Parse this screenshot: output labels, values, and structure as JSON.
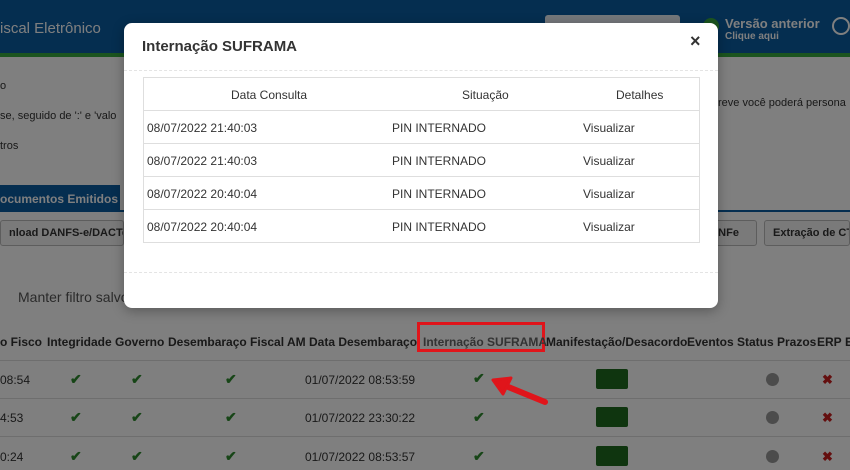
{
  "app": {
    "title": "iscal Eletrônico",
    "old_version_title": "Versão anterior",
    "old_version_sub": "Clique aqui"
  },
  "background": {
    "hint1": "se, seguido de ':' e 'valo",
    "hint2": "tros",
    "hint3": "reve você poderá persona",
    "hint4": "o",
    "tab_label": "ocumentos Emitidos",
    "btn_download": "nload DANFS-e/DACTes (P",
    "btn_nfe": "e NFe",
    "btn_extract": "Extração de CTe",
    "filter_text": "Manter filtro salvo"
  },
  "grid": {
    "headers": [
      "o Fisco",
      "Integridade",
      "Governo",
      "Desembaraço Fiscal AM",
      "Data Desembaraço",
      "Internação SUFRAMA",
      "Manifestação/Desacordo",
      "Eventos",
      "Status Prazos",
      "ERP",
      "E"
    ],
    "rows": [
      {
        "fisco": "08:54",
        "date": "01/07/2022 08:53:59"
      },
      {
        "fisco": "4:53",
        "date": "01/07/2022 23:30:22"
      },
      {
        "fisco": "0:24",
        "date": "01/07/2022 08:53:57"
      }
    ]
  },
  "modal": {
    "title": "Internação SUFRAMA",
    "close": "×",
    "columns": [
      "Data Consulta",
      "Situação",
      "Detalhes"
    ],
    "rows": [
      {
        "data": "08/07/2022 21:40:03",
        "situacao": "PIN INTERNADO",
        "detalhes": "Visualizar"
      },
      {
        "data": "08/07/2022 21:40:03",
        "situacao": "PIN INTERNADO",
        "detalhes": "Visualizar"
      },
      {
        "data": "08/07/2022 20:40:04",
        "situacao": "PIN INTERNADO",
        "detalhes": "Visualizar"
      },
      {
        "data": "08/07/2022 20:40:04",
        "situacao": "PIN INTERNADO",
        "detalhes": "Visualizar"
      }
    ]
  },
  "icons": {
    "check": "✔",
    "cross": "✖"
  },
  "colors": {
    "header_blue": "#0b5ca1",
    "accent_green": "#36a93f",
    "highlight_red": "#e0151b"
  }
}
